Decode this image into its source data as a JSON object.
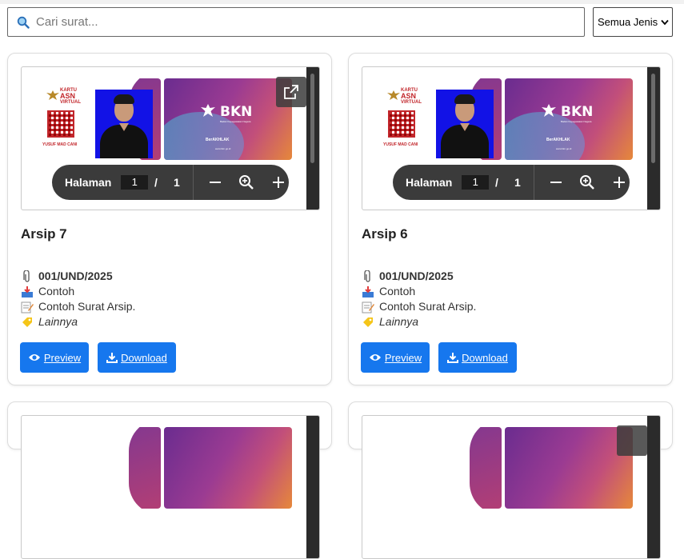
{
  "search": {
    "placeholder": "Cari surat..."
  },
  "filter": {
    "selected": "Semua Jenis"
  },
  "viewer": {
    "page_label": "Halaman",
    "current_page": "1",
    "separator": "/",
    "total_pages": "1"
  },
  "cards": [
    {
      "title": "Arsip 7",
      "number": "001/UND/2025",
      "sender": "Contoh",
      "description": "Contoh Surat Arsip.",
      "category": "Lainnya",
      "preview_label": "Preview",
      "download_label": "Download"
    },
    {
      "title": "Arsip 6",
      "number": "001/UND/2025",
      "sender": "Contoh",
      "description": "Contoh Surat Arsip.",
      "category": "Lainnya",
      "preview_label": "Preview",
      "download_label": "Download"
    }
  ],
  "document_preview": {
    "left_card": {
      "line1": "KARTU",
      "line2": "ASN",
      "line3": "VIRTUAL",
      "name": "YUSUF MAD CANI"
    },
    "right_card": {
      "brand": "BKN",
      "subtitle": "Badan Kepegawaian Negara",
      "motto": "BerAKHLAK",
      "url": "www.bkn.go.id"
    }
  },
  "colors": {
    "primary_button": "#1677ee",
    "toolbar": "#3b3b3b",
    "brand_gradient_start": "#6a2c8f",
    "brand_gradient_end": "#e6883a"
  }
}
